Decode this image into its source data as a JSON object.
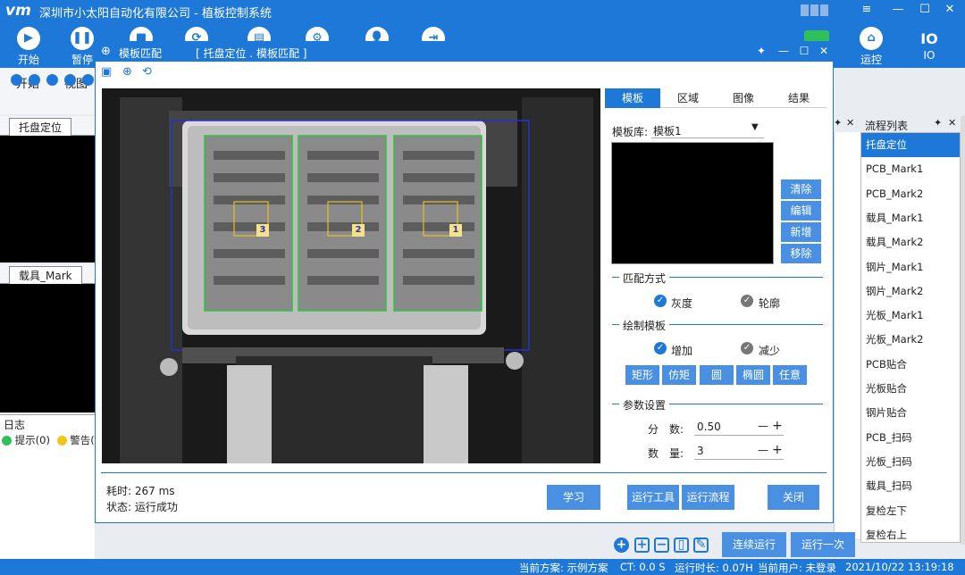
{
  "app": {
    "logo": "vm",
    "title": "深圳市小太阳自动化有限公司 - 植板控制系统"
  },
  "window_controls": [
    "≡",
    "—",
    "☐",
    "✕"
  ],
  "toolbar": {
    "left": [
      {
        "label": "开始",
        "icon": "▶"
      },
      {
        "label": "暂停",
        "icon": "❚❚"
      },
      {
        "label": "",
        "icon": "■"
      },
      {
        "label": "",
        "icon": "⟳"
      },
      {
        "label": "",
        "icon": "▤"
      },
      {
        "label": "",
        "icon": "⚙"
      },
      {
        "label": "",
        "icon": "👤"
      },
      {
        "label": "",
        "icon": "⇥"
      }
    ],
    "right": [
      {
        "label": "运控",
        "icon": "⌂"
      },
      {
        "label": "IO",
        "icon": "IO"
      }
    ]
  },
  "menubar": {
    "items": [
      "开始",
      "视图"
    ]
  },
  "left_panels": {
    "panel1_tab": "托盘定位",
    "panel2_tab": "载具_Mark",
    "log": {
      "title": "日志",
      "hint": "提示(0)",
      "warn": "警告("
    }
  },
  "dialog": {
    "title": "模板匹配",
    "context": "[ 托盘定位 . 模板匹配 ]",
    "tabs": [
      "模板",
      "区域",
      "图像",
      "结果"
    ],
    "template_lib_label": "模板库:",
    "template_lib_value": "模板1",
    "side_buttons": [
      "清除",
      "编辑",
      "新增",
      "移除"
    ],
    "match_section": "匹配方式",
    "match_opts": [
      "灰度",
      "轮廓"
    ],
    "draw_section": "绘制模板",
    "draw_opts": [
      "增加",
      "减少"
    ],
    "shape_buttons": [
      "矩形",
      "仿矩",
      "圆",
      "椭圆",
      "任意"
    ],
    "param_section": "参数设置",
    "params": [
      {
        "label": "分　数:",
        "value": "0.50"
      },
      {
        "label": "数　量:",
        "value": "3"
      }
    ],
    "elapsed": "耗时:  267 ms",
    "status": "状态:  运行成功",
    "footer_buttons": [
      "学习",
      "运行工具",
      "运行流程",
      "关闭"
    ],
    "image_markers": [
      "3",
      "2",
      "1"
    ]
  },
  "flow_list": {
    "title": "流程列表",
    "items": [
      "托盘定位",
      "PCB_Mark1",
      "PCB_Mark2",
      "载具_Mark1",
      "载具_Mark2",
      "钢片_Mark1",
      "钢片_Mark2",
      "光板_Mark1",
      "光板_Mark2",
      "PCB贴合",
      "光板贴合",
      "钢片贴合",
      "PCB_扫码",
      "光板_扫码",
      "载具_扫码",
      "复检左下",
      "复检右上"
    ],
    "selected_index": 0
  },
  "bottom_actions": {
    "run_continuous": "连续运行",
    "run_once": "运行一次"
  },
  "statusbar": {
    "scheme": "当前方案: 示例方案",
    "ct": "CT: 0.0 S",
    "runtime": "运行时长: 0.07H",
    "user": "当前用户: 未登录",
    "datetime": "2021/10/22 13:19:18"
  }
}
